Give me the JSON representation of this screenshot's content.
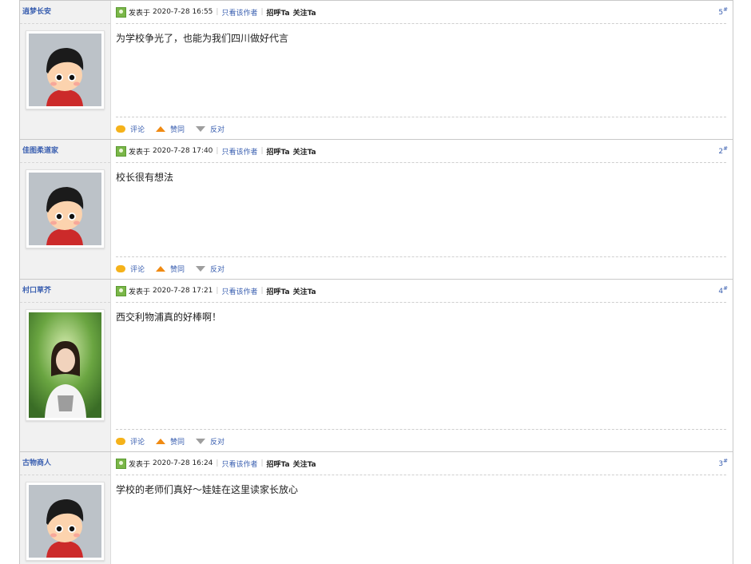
{
  "posts": [
    {
      "author": "逍梦长安",
      "posted_label": "发表于",
      "date": "2020-7-28 16:55",
      "only_author": "只看该作者",
      "greet": "招呼Ta",
      "follow": "关注Ta",
      "floor": "5",
      "floor_mark": "#",
      "content": "为学校争光了，也能为我们四川做好代言",
      "actions": {
        "comment": "评论",
        "like": "赞同",
        "dislike": "反对"
      },
      "avatar": "cartoon-avatar"
    },
    {
      "author": "佳图柔道家",
      "posted_label": "发表于",
      "date": "2020-7-28 17:40",
      "only_author": "只看该作者",
      "greet": "招呼Ta",
      "follow": "关注Ta",
      "floor": "2",
      "floor_mark": "#",
      "content": "校长很有想法",
      "actions": {
        "comment": "评论",
        "like": "赞同",
        "dislike": "反对"
      },
      "avatar": "cartoon-avatar"
    },
    {
      "author": "村口草芥",
      "posted_label": "发表于",
      "date": "2020-7-28 17:21",
      "only_author": "只看该作者",
      "greet": "招呼Ta",
      "follow": "关注Ta",
      "floor": "4",
      "floor_mark": "#",
      "content": "西交利物浦真的好棒啊！",
      "actions": {
        "comment": "评论",
        "like": "赞同",
        "dislike": "反对"
      },
      "avatar": "photo-avatar"
    },
    {
      "author": "古物商人",
      "posted_label": "发表于",
      "date": "2020-7-28 16:24",
      "only_author": "只看该作者",
      "greet": "招呼Ta",
      "follow": "关注Ta",
      "floor": "3",
      "floor_mark": "#",
      "content": "学校的老师们真好～娃娃在这里读家长放心",
      "avatar": "cartoon-avatar"
    }
  ]
}
